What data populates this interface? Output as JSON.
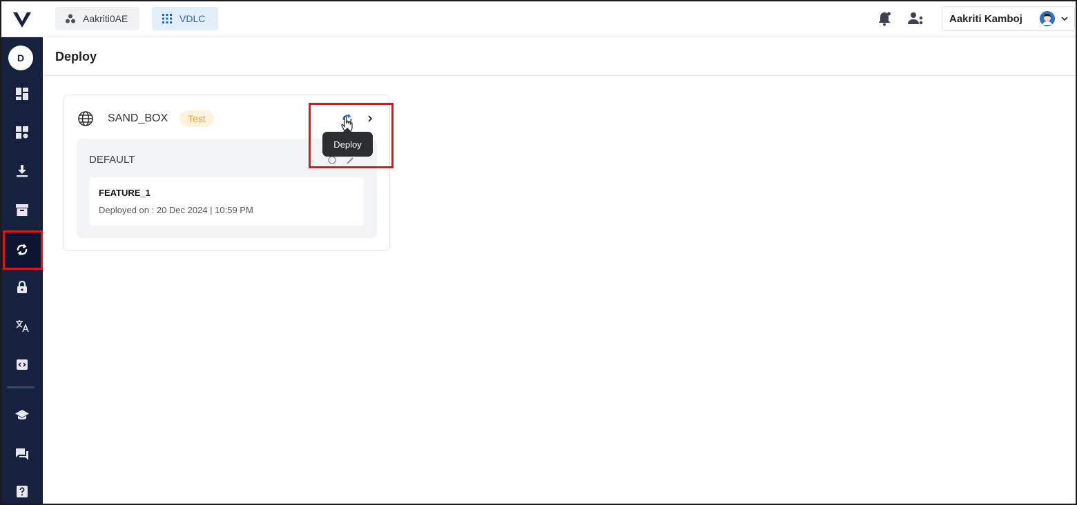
{
  "topbar": {
    "org_label": "Aakriti0AE",
    "app_label": "VDLC",
    "user_name": "Aakriti Kamboj"
  },
  "sidebar": {
    "avatar_letter": "D",
    "items": [
      {
        "icon": "dashboard-icon"
      },
      {
        "icon": "widgets-settings-icon"
      },
      {
        "icon": "download-icon"
      },
      {
        "icon": "archive-icon"
      },
      {
        "icon": "sync-icon",
        "active": true
      },
      {
        "icon": "lock-icon"
      },
      {
        "icon": "translate-icon"
      },
      {
        "icon": "code-box-icon"
      },
      {
        "icon": "school-icon"
      },
      {
        "icon": "chat-icon"
      },
      {
        "icon": "help-icon"
      }
    ]
  },
  "page": {
    "title": "Deploy"
  },
  "environment": {
    "name": "SAND_BOX",
    "badge": "Test",
    "group": "DEFAULT",
    "feature": {
      "name": "FEATURE_1",
      "deployed_on": "Deployed on : 20 Dec 2024 | 10:59 PM"
    }
  },
  "tooltip": {
    "label": "Deploy"
  },
  "colors": {
    "sidebar": "#16213e",
    "highlight": "#e0141b",
    "accent": "#1f67c6",
    "badge_text": "#e8a13a"
  }
}
